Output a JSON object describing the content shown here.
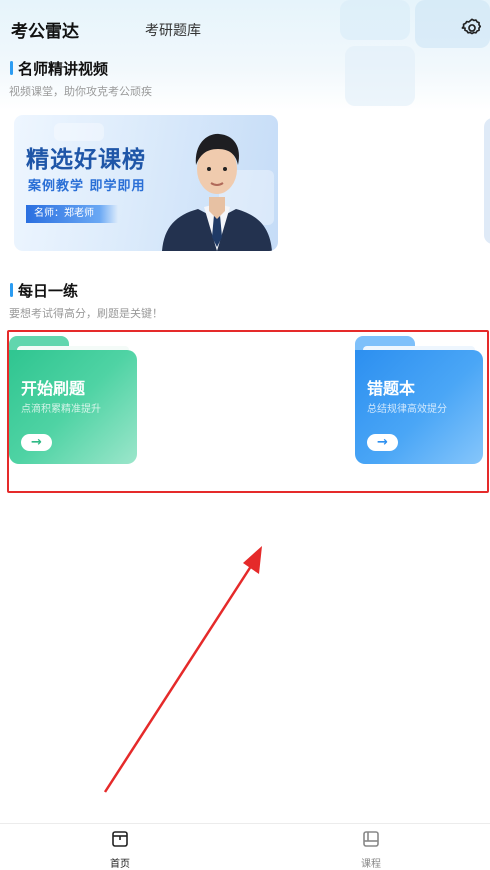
{
  "header": {
    "active_tab": "考公雷达",
    "tab": "考研题库",
    "settings_icon": "gear-icon"
  },
  "video_section": {
    "title": "名师精讲视频",
    "subtitle": "视频课堂，助你攻克考公顽疾",
    "banner": {
      "title": "精选好课榜",
      "subtitle": "案例教学 即学即用",
      "teacher": "名师：郑老师"
    }
  },
  "practice_section": {
    "title": "每日一练",
    "subtitle": "要想考试得高分，刷题是关键！",
    "cards": [
      {
        "title": "开始刷题",
        "subtitle": "点滴积累精准提升",
        "color": "#3dcb9a",
        "button_icon": "arrow-right-icon"
      },
      {
        "title": "错题本",
        "subtitle": "总结规律高效提分",
        "color": "#3a9ef5",
        "button_icon": "arrow-right-icon"
      }
    ]
  },
  "bottom_nav": {
    "items": [
      {
        "label": "首页",
        "icon": "home-icon",
        "active": true
      },
      {
        "label": "课程",
        "icon": "course-icon",
        "active": false
      }
    ]
  },
  "annotation": {
    "highlight_color": "#e52a2a"
  }
}
